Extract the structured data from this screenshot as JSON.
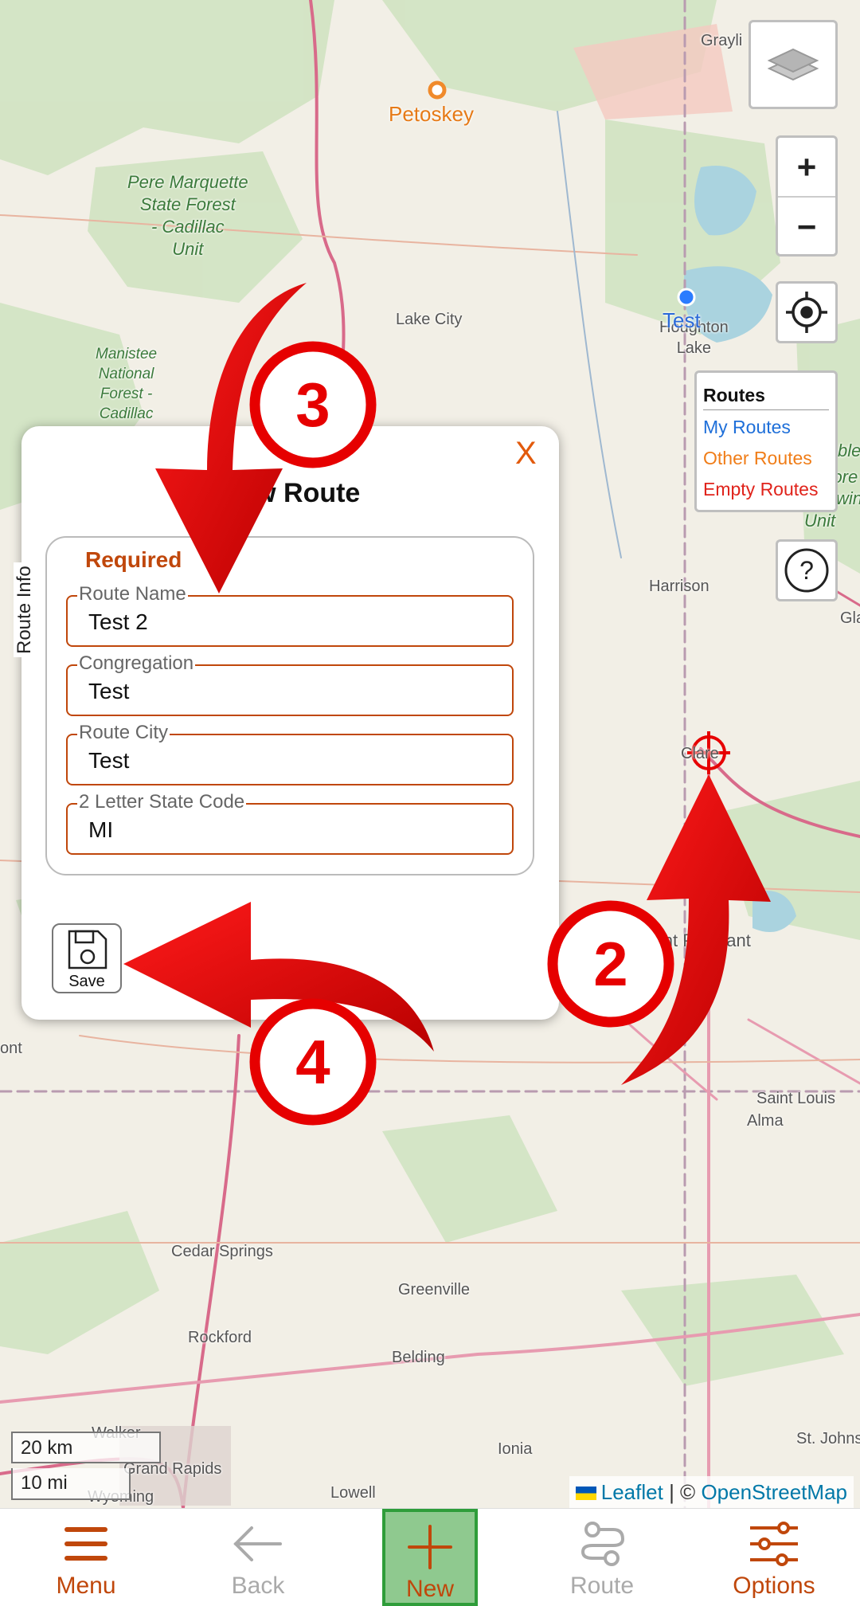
{
  "map": {
    "places": {
      "petoskey": "Petoskey",
      "grayling": "Grayli",
      "pere_marquette": "Pere Marquette\nState Forest\n- Cadillac\nUnit",
      "lake_city": "Lake City",
      "houghton_lake": "Houghton\nLake",
      "manistee": "Manistee\nNational\nForest -\nCadillac",
      "cadillac": "Cadillac",
      "harrison": "Harrison",
      "clare": "Clare",
      "mt_pleasant": "Mount Pleasant",
      "saint_louis": "Saint Louis",
      "alma": "Alma",
      "cedar_springs": "Cedar Springs",
      "greenville": "Greenville",
      "rockford": "Rockford",
      "belding": "Belding",
      "ionia": "Ionia",
      "grand_rapids": "Grand Rapids",
      "walker": "Walker",
      "wyoming": "Wyoming",
      "lowell": "Lowell",
      "st_johns": "St. Johns",
      "gla": "Gla",
      "able": "ble",
      "fore": "Fore",
      "wi": "win",
      "unit": "Unit",
      "ont": "ont"
    },
    "marker_label": "Test",
    "scale": {
      "km": "20 km",
      "mi": "10 mi"
    },
    "attribution": {
      "leaflet": "Leaflet",
      "separator": " | © ",
      "osm": "OpenStreetMap"
    }
  },
  "controls": {
    "zoom_in": "+",
    "zoom_out": "−",
    "legend": {
      "title": "Routes",
      "items": [
        {
          "label": "My Routes",
          "color": "#1e6fd9"
        },
        {
          "label": "Other Routes",
          "color": "#f07d18"
        },
        {
          "label": "Empty Routes",
          "color": "#e0231b"
        }
      ]
    }
  },
  "dialog": {
    "close": "X",
    "title": "New Route",
    "section_label": "Route Info",
    "required": "Required",
    "fields": [
      {
        "label": "Route Name",
        "value": "Test 2"
      },
      {
        "label": "Congregation",
        "value": "Test"
      },
      {
        "label": "Route City",
        "value": "Test"
      },
      {
        "label": "2 Letter State Code",
        "value": "MI"
      }
    ],
    "save": "Save"
  },
  "annotations": {
    "step2": "2",
    "step3": "3",
    "step4": "4"
  },
  "nav": {
    "items": [
      {
        "label": "Menu",
        "icon": "hamburger-icon"
      },
      {
        "label": "Back",
        "icon": "arrow-left-icon"
      },
      {
        "label": "New",
        "icon": "plus-icon"
      },
      {
        "label": "Route",
        "icon": "route-icon"
      },
      {
        "label": "Options",
        "icon": "sliders-icon"
      }
    ]
  },
  "colors": {
    "accent": "#c0470b",
    "map_bg": "#f2efe6",
    "annotation": "#e60000"
  }
}
